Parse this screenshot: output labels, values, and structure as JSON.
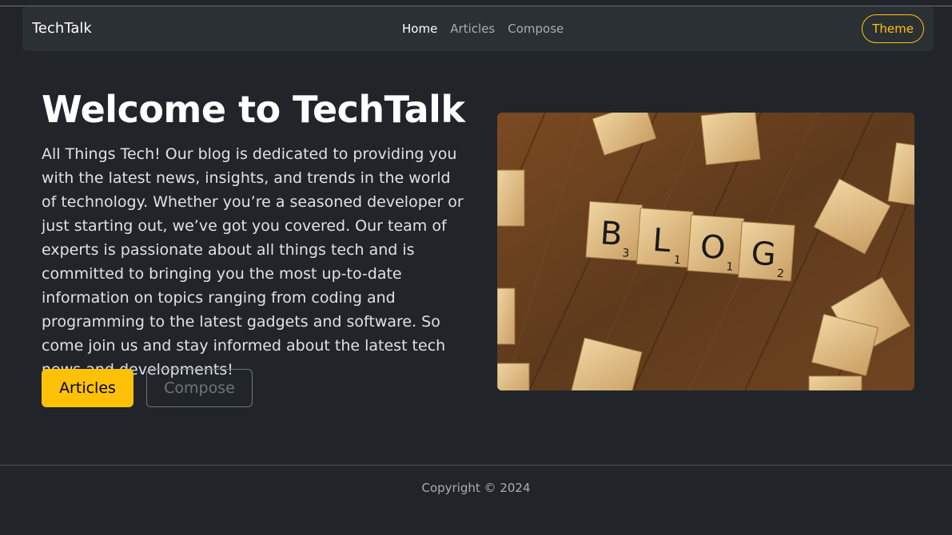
{
  "nav": {
    "brand": "TechTalk",
    "links": [
      "Home",
      "Articles",
      "Compose"
    ],
    "theme_label": "Theme"
  },
  "hero": {
    "title": "Welcome to TechTalk",
    "text": "All Things Tech! Our blog is dedicated to providing you with the latest news, insights, and trends in the world of technology. Whether you’re a seasoned developer or just starting out, we’ve got you covered. Our team of experts is passionate about all things tech and is committed to bringing you the most up-to-date information on topics ranging from coding and programming to the latest gadgets and software. So come join us and stay informed about the latest tech news and developments!",
    "primary_button": "Articles",
    "secondary_button": "Compose",
    "image": {
      "letters": [
        "B",
        "L",
        "O",
        "G"
      ],
      "scores": [
        "3",
        "1",
        "1",
        "2"
      ]
    }
  },
  "footer": {
    "copyright": "Copyright © 2024"
  },
  "colors": {
    "background": "#212529",
    "navbar": "#2b3035",
    "accent": "#ffc107"
  }
}
